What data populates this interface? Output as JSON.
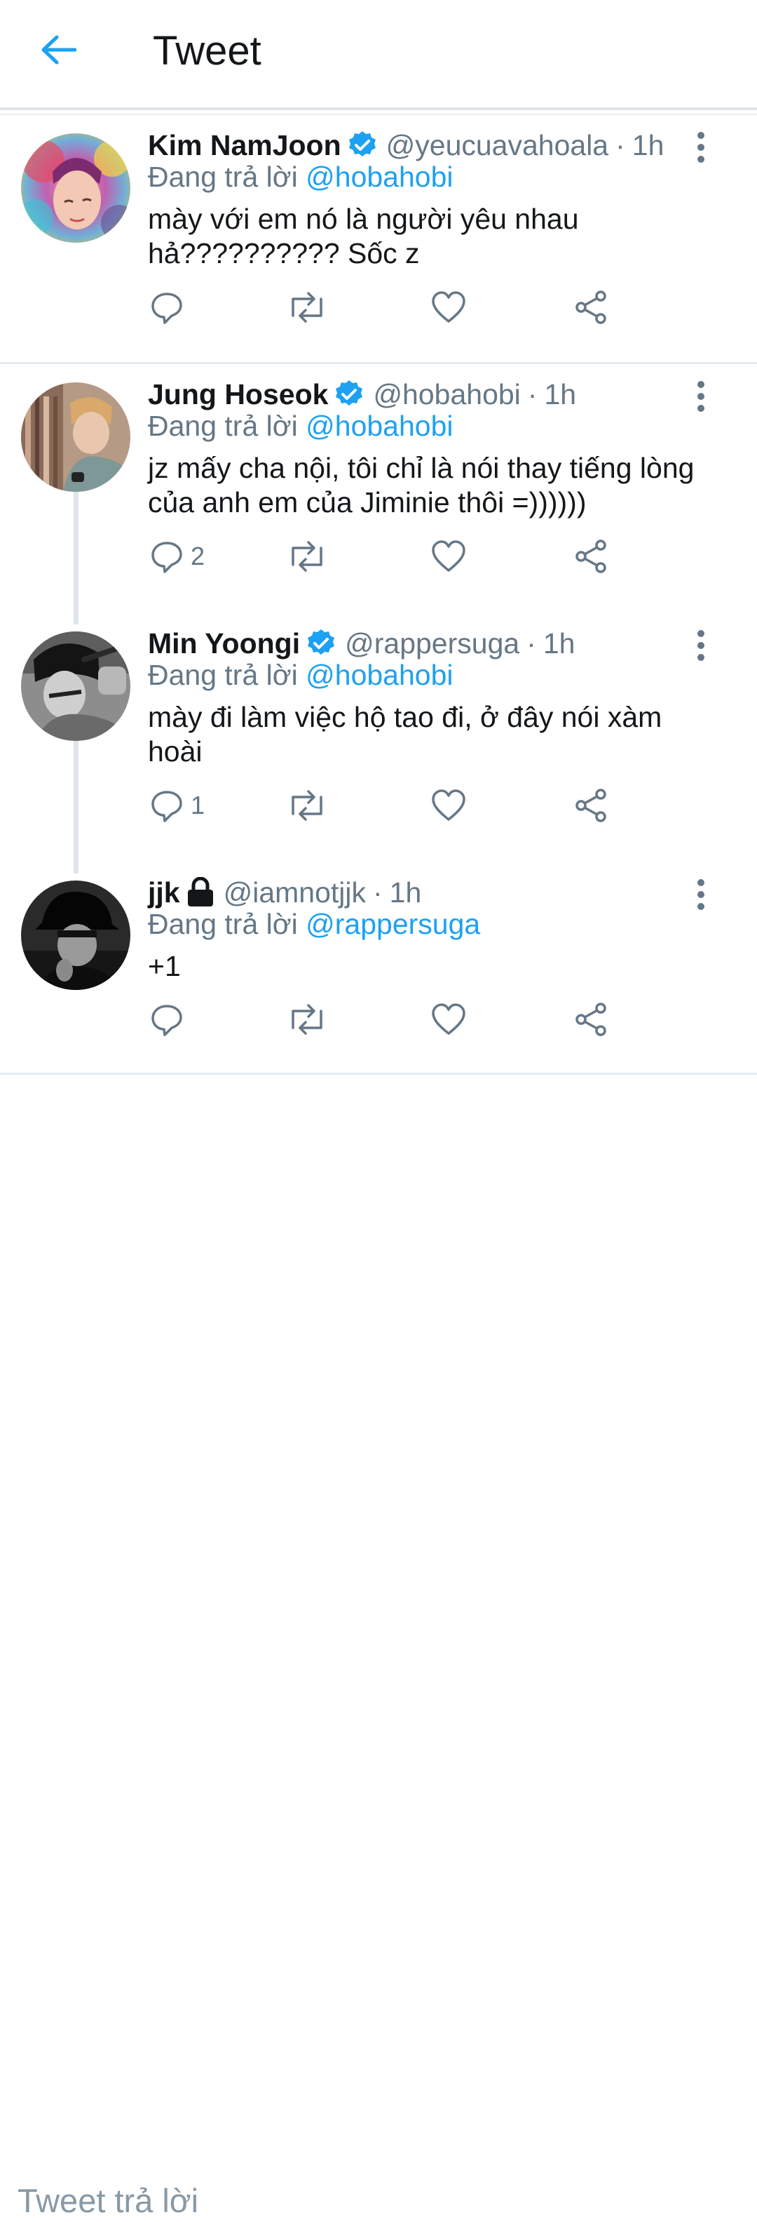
{
  "header": {
    "title": "Tweet"
  },
  "colors": {
    "accent": "#1da1f2",
    "muted": "#657786",
    "divider": "#e6ecf0"
  },
  "icons": {
    "back": "arrow-left-icon",
    "verified": "verified-badge-icon",
    "locked": "lock-icon",
    "more": "more-vertical-icon",
    "reply": "reply-icon",
    "retweet": "retweet-icon",
    "like": "heart-icon",
    "share": "share-icon"
  },
  "tweets": [
    {
      "name": "Kim NamJoon",
      "verified": true,
      "handle": "@yeucuavahoala",
      "time": "1h",
      "reply_prefix": "Đang trả lời",
      "reply_to": "@hobahobi",
      "text": "mày với em nó là người yêu nhau hả?????????? Sốc z",
      "reply_count": ""
    },
    {
      "name": "Jung Hoseok",
      "verified": true,
      "handle": "@hobahobi",
      "time": "1h",
      "reply_prefix": "Đang trả lời",
      "reply_to": "@hobahobi",
      "text": "jz mấy cha nội, tôi chỉ là nói thay tiếng lòng của anh em của Jiminie thôi =))))))",
      "reply_count": "2"
    },
    {
      "name": "Min Yoongi",
      "verified": true,
      "handle": "@rappersuga",
      "time": "1h",
      "reply_prefix": "Đang trả lời",
      "reply_to": "@hobahobi",
      "text": "mày đi làm việc hộ tao đi, ở đây nói xàm hoài",
      "reply_count": "1"
    },
    {
      "name": "jjk",
      "verified": false,
      "locked": true,
      "handle": "@iamnotjjk",
      "time": "1h",
      "reply_prefix": "Đang trả lời",
      "reply_to": "@rappersuga",
      "text": "+1",
      "reply_count": ""
    }
  ],
  "composer": {
    "placeholder": "Tweet trả lời"
  }
}
